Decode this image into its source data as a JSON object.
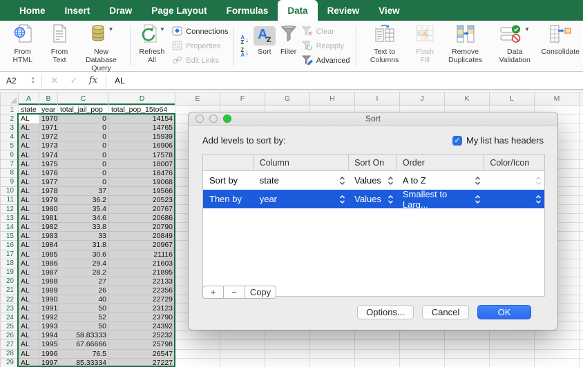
{
  "colors": {
    "excel_green": "#1e7245",
    "selection_blue": "#1b5cdc",
    "ok_blue": "#2e74f0",
    "checkbox_blue": "#2a6fe4",
    "selection_gray": "#d4d4d4"
  },
  "menubar": {
    "tabs": [
      "Home",
      "Insert",
      "Draw",
      "Page Layout",
      "Formulas",
      "Data",
      "Review",
      "View"
    ],
    "active_tab": "Data"
  },
  "ribbon": {
    "from_html": "From HTML",
    "from_text": "From Text",
    "new_db_query": "New Database Query",
    "refresh_all": "Refresh All",
    "connections": "Connections",
    "properties": "Properties",
    "edit_links": "Edit Links",
    "sort": "Sort",
    "filter": "Filter",
    "clear": "Clear",
    "reapply": "Reapply",
    "advanced": "Advanced",
    "text_to_columns": "Text to Columns",
    "flash_fill": "Flash Fill",
    "remove_duplicates": "Remove Duplicates",
    "data_validation": "Data Validation",
    "consolidate": "Consolidate"
  },
  "formula_bar": {
    "name_box": "A2",
    "fx_label": "fx",
    "cell_value": "AL"
  },
  "spreadsheet": {
    "columns": [
      "A",
      "B",
      "C",
      "D",
      "E",
      "F",
      "G",
      "H",
      "I",
      "J",
      "K",
      "L",
      "M"
    ],
    "selected_columns": [
      "A",
      "B",
      "C",
      "D"
    ],
    "header_row": [
      "state",
      "year",
      "total_jail_pop",
      "total_pop_15to64"
    ],
    "active_cell": "A2",
    "rows": [
      [
        "AL",
        "1970",
        "0",
        "14154"
      ],
      [
        "AL",
        "1971",
        "0",
        "14765"
      ],
      [
        "AL",
        "1972",
        "0",
        "15939"
      ],
      [
        "AL",
        "1973",
        "0",
        "16906"
      ],
      [
        "AL",
        "1974",
        "0",
        "17578"
      ],
      [
        "AL",
        "1975",
        "0",
        "18007"
      ],
      [
        "AL",
        "1976",
        "0",
        "18476"
      ],
      [
        "AL",
        "1977",
        "0",
        "19068"
      ],
      [
        "AL",
        "1978",
        "37",
        "19566"
      ],
      [
        "AL",
        "1979",
        "36.2",
        "20523"
      ],
      [
        "AL",
        "1980",
        "35.4",
        "20767"
      ],
      [
        "AL",
        "1981",
        "34.6",
        "20686"
      ],
      [
        "AL",
        "1982",
        "33.8",
        "20790"
      ],
      [
        "AL",
        "1983",
        "33",
        "20849"
      ],
      [
        "AL",
        "1984",
        "31.8",
        "20967"
      ],
      [
        "AL",
        "1985",
        "30.6",
        "21116"
      ],
      [
        "AL",
        "1986",
        "29.4",
        "21603"
      ],
      [
        "AL",
        "1987",
        "28.2",
        "21895"
      ],
      [
        "AL",
        "1988",
        "27",
        "22133"
      ],
      [
        "AL",
        "1989",
        "26",
        "22356"
      ],
      [
        "AL",
        "1990",
        "40",
        "22729"
      ],
      [
        "AL",
        "1991",
        "50",
        "23123"
      ],
      [
        "AL",
        "1992",
        "52",
        "23790"
      ],
      [
        "AL",
        "1993",
        "50",
        "24392"
      ],
      [
        "AL",
        "1994",
        "58.83333",
        "25232"
      ],
      [
        "AL",
        "1995",
        "67.66666",
        "25798"
      ],
      [
        "AL",
        "1996",
        "76.5",
        "26547"
      ],
      [
        "AL",
        "1997",
        "85.33334",
        "27227"
      ]
    ]
  },
  "sort_dialog": {
    "title": "Sort",
    "add_levels_label": "Add levels to sort by:",
    "headers_checkbox_label": "My list has headers",
    "headers_checked": true,
    "table_headers": [
      "Column",
      "Sort On",
      "Order",
      "Color/Icon"
    ],
    "levels": [
      {
        "label": "Sort by",
        "column": "state",
        "sort_on": "Values",
        "order": "A to Z",
        "selected": false
      },
      {
        "label": "Then by",
        "column": "year",
        "sort_on": "Values",
        "order": "Smallest to Larg...",
        "selected": true
      }
    ],
    "add_button": "+",
    "remove_button": "−",
    "copy_button": "Copy",
    "options_button": "Options...",
    "cancel_button": "Cancel",
    "ok_button": "OK"
  }
}
